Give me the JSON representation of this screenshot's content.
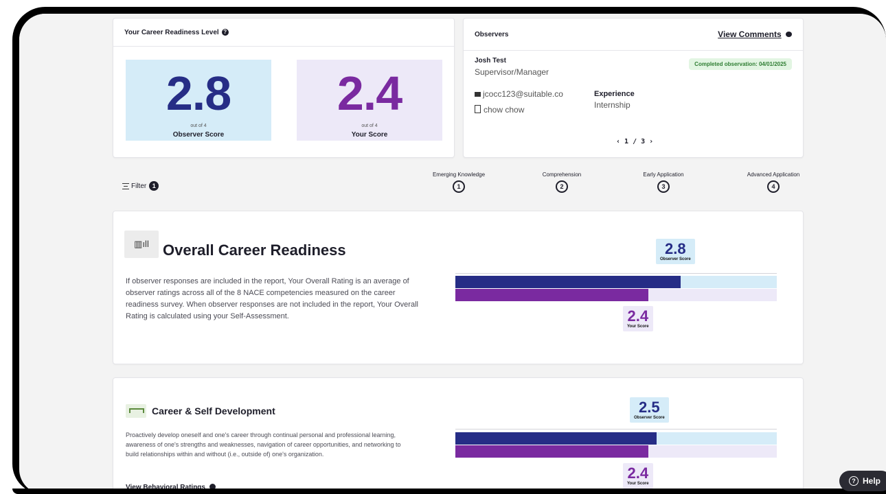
{
  "readiness_card": {
    "title": "Your Career Readiness Level",
    "help_icon": "question-circle-icon",
    "observer_score": "2.8",
    "observer_out_of": "out of 4",
    "observer_label": "Observer Score",
    "your_score": "2.4",
    "your_out_of": "out of 4",
    "your_label": "Your Score"
  },
  "observers_card": {
    "title": "Observers",
    "view_comments": "View Comments",
    "name": "Josh Test",
    "role": "Supervisor/Manager",
    "badge": "Completed observation: 04/01/2025",
    "email": "jcocc123@suitable.co",
    "org": "chow chow",
    "experience_label": "Experience",
    "experience_value": "Internship",
    "pager": "1 / 3"
  },
  "filter": {
    "label": "Filter",
    "count": "1"
  },
  "levels": [
    {
      "label": "Emerging Knowledge",
      "num": "1"
    },
    {
      "label": "Comprehension",
      "num": "2"
    },
    {
      "label": "Early Application",
      "num": "3"
    },
    {
      "label": "Advanced Application",
      "num": "4"
    }
  ],
  "overall": {
    "title": "Overall Career Readiness",
    "description": "If observer responses are included in the report, Your Overall Rating is an average of observer ratings across all of the 8 NACE competencies measured on the career readiness survey. When observer responses are not included in the report, Your Overall Rating is calculated using your Self-Assessment.",
    "observer_score": "2.8",
    "observer_label": "Observer Score",
    "your_score": "2.4",
    "your_label": "Your Score"
  },
  "career": {
    "title": "Career & Self Development",
    "description": "Proactively develop oneself and one's career through continual personal and professional learning, awareness of one's strengths and weaknesses, navigation of career opportunities, and networking to build relationships within and without (i.e., outside of) one's organization.",
    "link": "View Behavioral Ratings",
    "observer_score": "2.5",
    "observer_label": "Observer Score",
    "your_score": "2.4",
    "your_label": "Your Score"
  },
  "help": {
    "label": "Help"
  },
  "colors": {
    "observer_navy": "#262d86",
    "observer_light": "#d5ecf8",
    "you_purple": "#7a2aa0",
    "you_light": "#ede9f8",
    "badge_green": "#2e7d32"
  }
}
